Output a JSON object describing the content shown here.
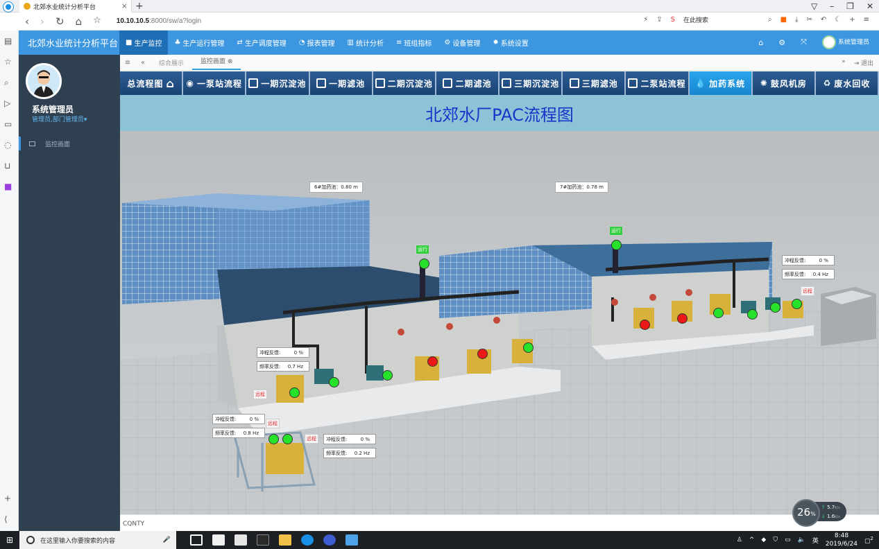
{
  "browser": {
    "tab_title": "北郊水业统计分析平台",
    "tab_close": "×",
    "new_tab": "+",
    "url_host": "10.10.10.5",
    "url_rest": ":8000/sw/a?login",
    "search_placeholder": "在此搜索"
  },
  "app": {
    "brand": "北郊水业统计分析平台",
    "menu": [
      {
        "label": "生产监控",
        "active": true
      },
      {
        "label": "生产运行管理"
      },
      {
        "label": "生产调度管理"
      },
      {
        "label": "报表管理"
      },
      {
        "label": "统计分析"
      },
      {
        "label": "班组指标"
      },
      {
        "label": "设备管理"
      },
      {
        "label": "系统设置"
      }
    ],
    "user_menu": "系统管理员"
  },
  "sidebar": {
    "user_name": "系统管理员",
    "user_role": "管理员,部门管理员▾",
    "items": [
      {
        "label": "监控画面"
      }
    ]
  },
  "tabs": {
    "items": [
      {
        "label": "综合展示"
      },
      {
        "label": "监控画面 ⊗"
      }
    ],
    "logout": "退出"
  },
  "process_nav": [
    {
      "label": "总流程图"
    },
    {
      "label": "一泵站流程"
    },
    {
      "label": "一期沉淀池"
    },
    {
      "label": "一期滤池"
    },
    {
      "label": "二期沉淀池"
    },
    {
      "label": "二期滤池"
    },
    {
      "label": "三期沉淀池"
    },
    {
      "label": "三期滤池"
    },
    {
      "label": "二泵站流程"
    },
    {
      "label": "加药系统",
      "active": true
    },
    {
      "label": "鼓风机房"
    },
    {
      "label": "废水回收"
    }
  ],
  "page_title": "北郊水厂PAC流程图",
  "scene": {
    "level6": "6#加药池：0.80 m",
    "level7": "7#加药池：0.78 m",
    "tag_on": "运行",
    "tag_remote": "远程",
    "pump_a": {
      "stroke_label": "冲程反馈:",
      "stroke": "0 %",
      "freq_label": "频率反馈:",
      "freq": "0.7 Hz"
    },
    "pump_b": {
      "stroke_label": "冲程反馈:",
      "stroke": "0 %",
      "freq_label": "频率反馈:",
      "freq": "0.8 Hz"
    },
    "pump_c": {
      "stroke_label": "冲程反馈:",
      "stroke": "0 %",
      "freq_label": "频率反馈:",
      "freq": "0.2 Hz"
    },
    "pump_d": {
      "stroke_label": "冲程反馈:",
      "stroke": "0 %",
      "freq_label": "频率反馈:",
      "freq": "0.4 Hz"
    }
  },
  "status_text": "CQNTY",
  "meter": {
    "value": "26",
    "unit": "%",
    "up": "5.7",
    "down": "1.6",
    "rate_unit": "K/s"
  },
  "taskbar": {
    "search_placeholder": "在这里输入你要搜索的内容",
    "ime": "英",
    "time": "8:48",
    "date": "2019/6/24",
    "notif": "2"
  }
}
